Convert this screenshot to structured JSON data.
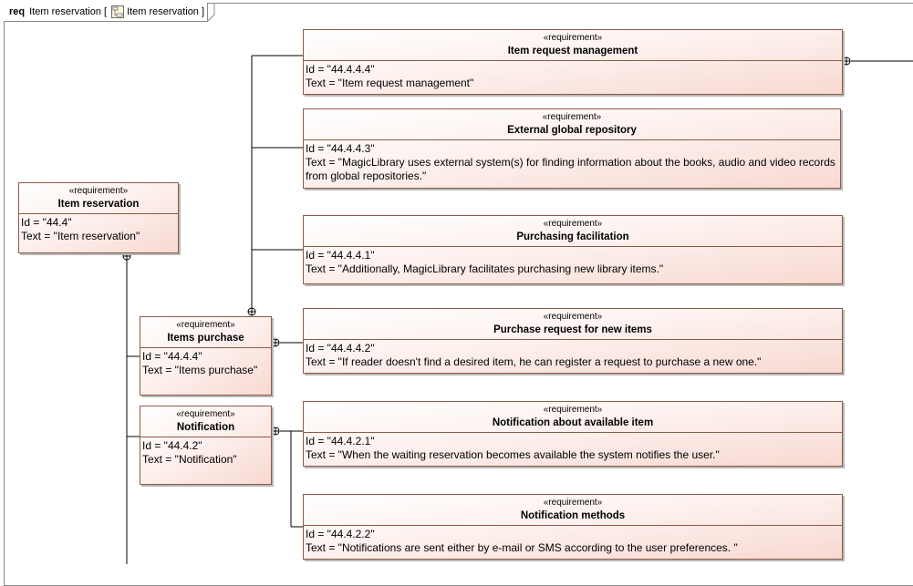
{
  "frame": {
    "keyword": "req",
    "name": "Item reservation",
    "bracket_open": "[",
    "bracket_close": "]",
    "diagram_name": "Item reservation",
    "icon": "diagram-icon"
  },
  "requirements": {
    "item_reservation": {
      "stereotype": "«requirement»",
      "name": "Item reservation",
      "id_line": "Id = \"44.4\"",
      "text_line": "Text = \"Item reservation\""
    },
    "item_request_management": {
      "stereotype": "«requirement»",
      "name": "Item request management",
      "id_line": "Id = \"44.4.4.4\"",
      "text_line": "Text = \"Item request management\""
    },
    "external_global_repository": {
      "stereotype": "«requirement»",
      "name": "External global repository",
      "id_line": "Id = \"44.4.4.3\"",
      "text_line": "Text = \"MagicLibrary uses external system(s) for finding information about the books, audio and video records from global repositories.\""
    },
    "purchasing_facilitation": {
      "stereotype": "«requirement»",
      "name": "Purchasing facilitation",
      "id_line": "Id = \"44.4.4.1\"",
      "text_line": "Text = \"Additionally, MagicLibrary facilitates purchasing new library items.\""
    },
    "items_purchase": {
      "stereotype": "«requirement»",
      "name": "Items purchase",
      "id_line": "Id = \"44.4.4\"",
      "text_line": "Text = \"Items purchase\""
    },
    "purchase_request": {
      "stereotype": "«requirement»",
      "name": "Purchase request for new items",
      "id_line": "Id = \"44.4.4.2\"",
      "text_line": "Text = \"If reader doesn't find a desired item, he can register a request to purchase a new one.\""
    },
    "notification": {
      "stereotype": "«requirement»",
      "name": "Notification",
      "id_line": "Id = \"44.4.2\"",
      "text_line": "Text = \"Notification\""
    },
    "notification_available": {
      "stereotype": "«requirement»",
      "name": "Notification about available item",
      "id_line": "Id = \"44.4.2.1\"",
      "text_line": "Text = \"When the waiting reservation becomes available the system notifies the user.\""
    },
    "notification_methods": {
      "stereotype": "«requirement»",
      "name": "Notification methods",
      "id_line": "Id = \"44.4.2.2\"",
      "text_line": "Text = \"Notifications are sent either by e-mail or SMS according to the user preferences. \""
    }
  },
  "colors": {
    "border": "#8e5b47",
    "fill_end": "#f8d9d2",
    "wire": "#000000"
  }
}
